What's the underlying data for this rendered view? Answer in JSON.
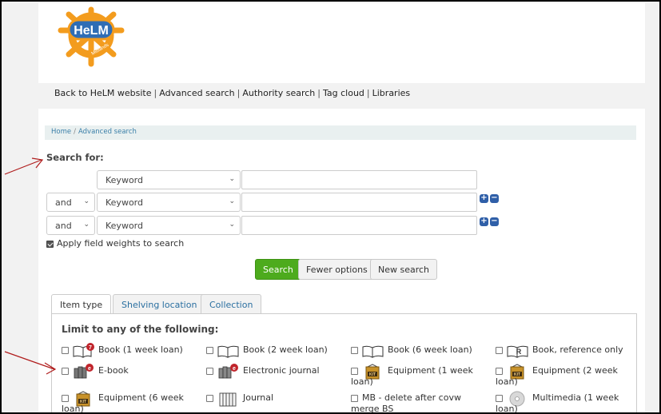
{
  "header": {
    "logo_text": "HeLM",
    "logo_subtext": "Midlands"
  },
  "nav": {
    "links": [
      "Back to HeLM website",
      "Advanced search",
      "Authority search",
      "Tag cloud",
      "Libraries"
    ],
    "separator": "|"
  },
  "breadcrumb": {
    "home": "Home",
    "divider": "/",
    "current": "Advanced search"
  },
  "search": {
    "heading": "Search for:",
    "rows": [
      {
        "operator": "",
        "field": "Keyword",
        "value": ""
      },
      {
        "operator": "and",
        "field": "Keyword",
        "value": ""
      },
      {
        "operator": "and",
        "field": "Keyword",
        "value": ""
      }
    ],
    "field_weights_label": "Apply field weights to search",
    "field_weights_checked": true
  },
  "buttons": {
    "search": "Search",
    "fewer": "Fewer options",
    "new": "New search"
  },
  "tabs": [
    "Item type",
    "Shelving location",
    "Collection"
  ],
  "limit": {
    "heading": "Limit to any of the following:",
    "items": [
      {
        "line1": "Book (1 week loan)",
        "line2": "",
        "icon": "book-badge-icon"
      },
      {
        "line1": "Book (2 week loan)",
        "line2": "",
        "icon": "book-open-icon"
      },
      {
        "line1": "Book (6 week loan)",
        "line2": "",
        "icon": "book-open-icon"
      },
      {
        "line1": "Book, reference only",
        "line2": "",
        "icon": "book-reference-icon"
      },
      {
        "line1": "E-book",
        "line2": "",
        "icon": "ebook-icon"
      },
      {
        "line1": "Electronic journal",
        "line2": "",
        "icon": "ejournal-icon"
      },
      {
        "line1": "Equipment (1 week",
        "line2": "loan)",
        "icon": "kit-icon"
      },
      {
        "line1": "Equipment (2 week",
        "line2": "loan)",
        "icon": "kit-icon"
      },
      {
        "line1": "Equipment (6 week",
        "line2": "loan)",
        "icon": "kit-icon"
      },
      {
        "line1": "Journal",
        "line2": "",
        "icon": "journal-icon"
      },
      {
        "line1": "MB - delete after covw",
        "line2": "merge BS",
        "icon": ""
      },
      {
        "line1": "Multimedia (1 week",
        "line2": "loan)",
        "icon": "disc-icon"
      }
    ]
  },
  "colors": {
    "accent_green": "#4dab1d",
    "link_blue": "#2a6fa0",
    "annotation_red": "#b01c1c",
    "logo_orange": "#f39c1e",
    "logo_blue": "#2f6db5"
  }
}
